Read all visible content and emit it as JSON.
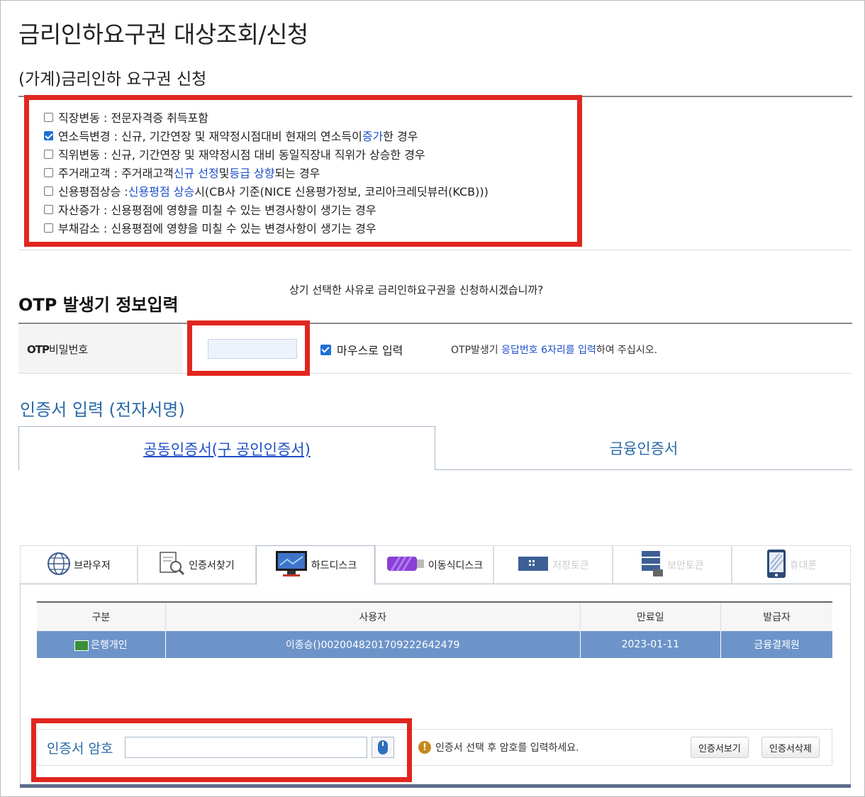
{
  "page_title": "금리인하요구권 대상조회/신청",
  "section_title": "(가계)금리인하 요구권 신청",
  "reasons": [
    {
      "checked": false,
      "label": "직장변동 : 전문자격증 취득포함"
    },
    {
      "checked": true,
      "label_a": "연소득변경 : 신규, 기간연장 및 재약정시점대비 현재의 연소득이 ",
      "label_b": "증가",
      "label_c": "한 경우"
    },
    {
      "checked": false,
      "label": "직위변동 : 신규, 기간연장 및 재약정시점 대비 동일직장내 직위가 상승한 경우"
    },
    {
      "checked": false,
      "label_a": "주거래고객 : 주거래고객 ",
      "label_b": "신규 선정",
      "label_c": " 및 ",
      "label_d": "등급 상향",
      "label_e": "되는 경우"
    },
    {
      "checked": false,
      "label_a": "신용평점상승 : ",
      "label_b": "신용평점 상승",
      "label_c": "시(CB사 기준(NICE 신용평가정보, 코리아크레딧뷰러(KCB)))"
    },
    {
      "checked": false,
      "label": "자산증가 : 신용평점에 영향을 미칠 수 있는 변경사항이 생기는 경우"
    },
    {
      "checked": false,
      "label": "부채감소 : 신용평점에 영향을 미칠 수 있는 변경사항이 생기는 경우"
    }
  ],
  "confirm_question": "상기 선택한 사유로 금리인하요구권을 신청하시겠습니까?",
  "otp": {
    "title": "OTP 발생기 정보입력",
    "label_bold": "OTP",
    "label_rest": "비밀번호",
    "input_value": "",
    "mouse_input_checked": true,
    "mouse_input_label": "마우스로 입력",
    "help_a": "OTP발생기 ",
    "help_b": "응답번호 6자리를 입력",
    "help_c": "하여 주십시오."
  },
  "cert": {
    "title": "인증서 입력 (전자서명)",
    "tabs": [
      "공동인증서(구 공인인증서)",
      "금융인증서"
    ],
    "active_tab": 0,
    "media_tabs": [
      {
        "label": "브라우저",
        "icon": "globe-icon",
        "enabled": true
      },
      {
        "label": "인증서찾기",
        "icon": "cert-search-icon",
        "enabled": true
      },
      {
        "label": "하드디스크",
        "icon": "monitor-icon",
        "enabled": true,
        "active": true
      },
      {
        "label": "이동식디스크",
        "icon": "usb-icon",
        "enabled": true
      },
      {
        "label": "저장토큰",
        "icon": "token-icon",
        "enabled": false
      },
      {
        "label": "보안토큰",
        "icon": "security-token-icon",
        "enabled": false
      },
      {
        "label": "휴대폰",
        "icon": "phone-icon",
        "enabled": false
      }
    ],
    "table": {
      "headers": [
        "구분",
        "사용자",
        "만료일",
        "발급자"
      ],
      "rows": [
        {
          "type": "은행개인",
          "user": "이종승()0020048201709222642479",
          "expiry": "2023-01-11",
          "issuer": "금융결제원"
        }
      ]
    },
    "password_label": "인증서 암호",
    "password_value": "",
    "password_hint": "인증서 선택 후 암호를 입력하세요.",
    "view_button": "인증서보기",
    "delete_button": "인증서삭제"
  },
  "colors": {
    "highlight_red": "#e0261f",
    "link_blue": "#1d4fc9",
    "selected_row": "#6d94c9"
  }
}
